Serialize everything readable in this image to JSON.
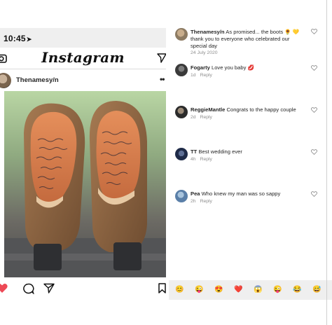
{
  "phone": {
    "status_time": "10:45",
    "app_logo": "Instagram",
    "post_username": "Thenamesy/n"
  },
  "comments": [
    {
      "user": "Thenamesy/n",
      "text": "As promised... the boots 🌻 💛 thank you to everyone who celebrated our special day",
      "time": "24 July 2020",
      "reply": "",
      "avatar_color": "#8d7b63"
    },
    {
      "user": "Fogarty",
      "text": "Love you baby 💋",
      "time": "1d",
      "reply": "Reply",
      "avatar_color": "#3a3a3a"
    },
    {
      "user": "ReggieMantle",
      "text": "Congrats to the happy couple",
      "time": "2d",
      "reply": "Reply",
      "avatar_color": "#2b2b2b"
    },
    {
      "user": "TT",
      "text": "Best wedding ever",
      "time": "4h",
      "reply": "Reply",
      "avatar_color": "#1f2b48"
    },
    {
      "user": "Pea",
      "text": "Who knew my man was so sappy",
      "time": "2h",
      "reply": "Reply",
      "avatar_color": "#5a7fa8"
    }
  ],
  "reactions": [
    "😊",
    "😜",
    "😍",
    "❤️",
    "😱",
    "😜",
    "😂",
    "😅"
  ],
  "icons": {
    "camera": "camera-icon",
    "send": "send-icon",
    "heart": "heart-icon",
    "comment": "comment-icon",
    "share": "share-icon",
    "bookmark": "bookmark-icon"
  },
  "colors": {
    "like_red": "#ed4956",
    "meta_gray": "#8e8e8e",
    "bar_gray": "#efefef"
  }
}
